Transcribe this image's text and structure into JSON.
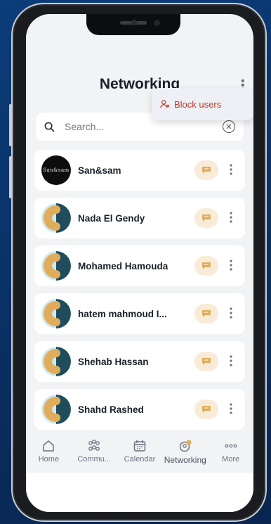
{
  "header": {
    "title": "Networking"
  },
  "menu": {
    "block_users_label": "Block users"
  },
  "search": {
    "placeholder": "Search..."
  },
  "contacts": [
    {
      "name": "San&sam",
      "avatar": "logo",
      "logo_text": "San&sam"
    },
    {
      "name": "Nada El Gendy",
      "avatar": "default"
    },
    {
      "name": "Mohamed Hamouda",
      "avatar": "default"
    },
    {
      "name": "hatem mahmoud I...",
      "avatar": "default"
    },
    {
      "name": "Shehab Hassan",
      "avatar": "default"
    },
    {
      "name": "Shahd Rashed",
      "avatar": "default"
    }
  ],
  "tabs": [
    {
      "label": "Home",
      "icon": "home-icon"
    },
    {
      "label": "Commu...",
      "icon": "community-icon"
    },
    {
      "label": "Calendar",
      "icon": "calendar-icon"
    },
    {
      "label": "Networking",
      "icon": "networking-icon",
      "active": true
    },
    {
      "label": "More",
      "icon": "more-icon"
    }
  ],
  "colors": {
    "accent": "#e0ad5c",
    "avatar_dark": "#1f4d5c",
    "avatar_light": "#cfe6ee",
    "block_red": "#c0392b",
    "message_bg": "#f8ecd8"
  }
}
